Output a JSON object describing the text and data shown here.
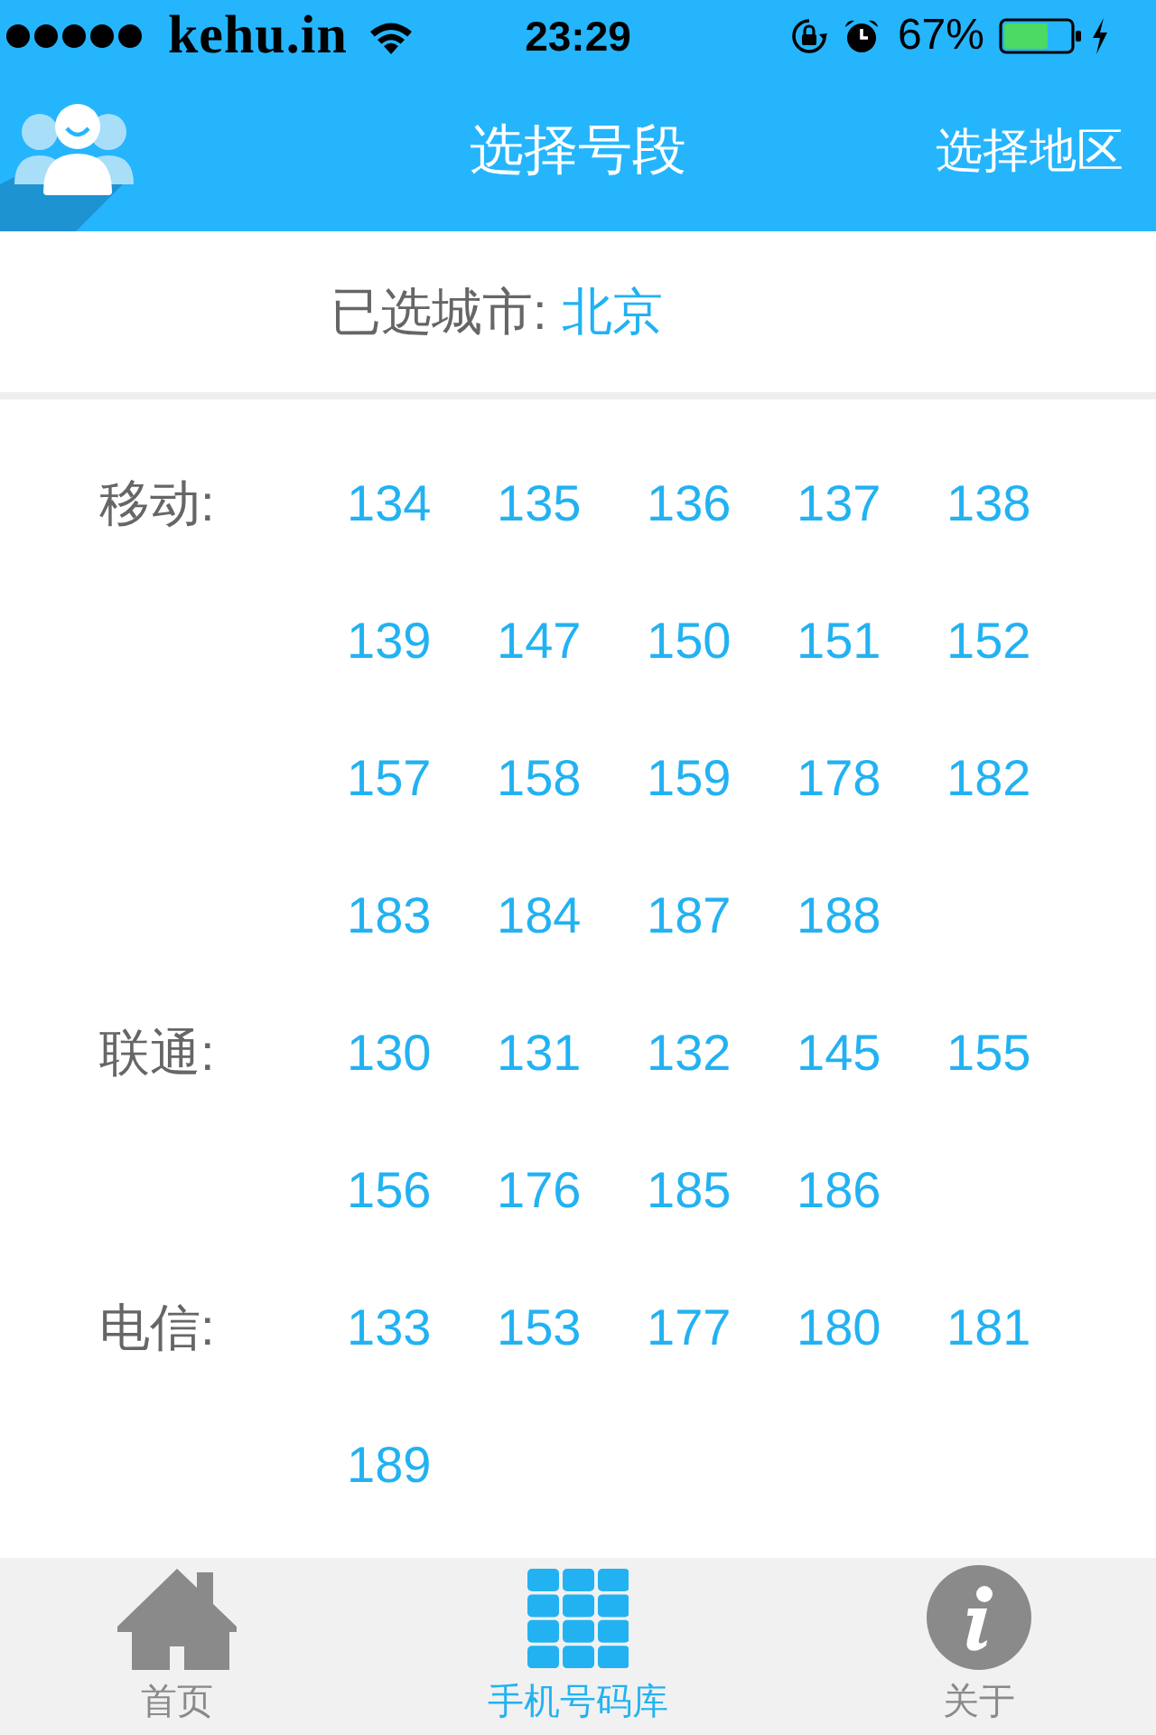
{
  "status_bar": {
    "carrier": "kehu.in",
    "time": "23:29",
    "battery": "67%"
  },
  "nav_bar": {
    "title": "选择号段",
    "action": "选择地区"
  },
  "selected_city": {
    "label": "已选城市:",
    "value": "北京"
  },
  "carriers": [
    {
      "name": "移动:",
      "prefixes": [
        "134",
        "135",
        "136",
        "137",
        "138",
        "139",
        "147",
        "150",
        "151",
        "152",
        "157",
        "158",
        "159",
        "178",
        "182",
        "183",
        "184",
        "187",
        "188"
      ]
    },
    {
      "name": "联通:",
      "prefixes": [
        "130",
        "131",
        "132",
        "145",
        "155",
        "156",
        "176",
        "185",
        "186"
      ]
    },
    {
      "name": "电信:",
      "prefixes": [
        "133",
        "153",
        "177",
        "180",
        "181",
        "189"
      ]
    }
  ],
  "tab_bar": [
    {
      "kind": "home",
      "label": "首页",
      "selected": false
    },
    {
      "kind": "grid",
      "label": "手机号码库",
      "selected": true
    },
    {
      "kind": "info",
      "label": "关于",
      "selected": false
    }
  ]
}
